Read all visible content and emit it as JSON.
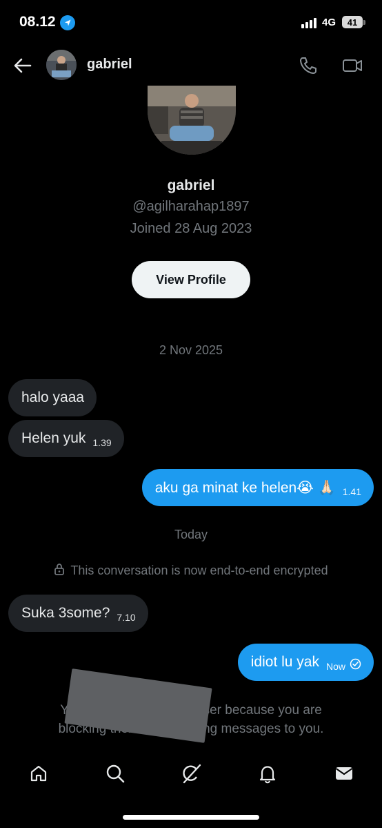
{
  "status_bar": {
    "time": "08.12",
    "network": "4G",
    "battery": "41"
  },
  "header": {
    "name": "gabriel"
  },
  "profile": {
    "name": "gabriel",
    "handle": "@agilharahap1897",
    "joined": "Joined 28 Aug 2023",
    "view_profile": "View Profile"
  },
  "dates": {
    "first": "2 Nov 2025",
    "today": "Today"
  },
  "messages": [
    {
      "side": "in",
      "text": "halo yaaa",
      "time": ""
    },
    {
      "side": "in",
      "text": "Helen yuk",
      "time": "1.39"
    },
    {
      "side": "out",
      "text": "aku ga minat ke helen😭 🙏🏻",
      "time": "1.41"
    },
    {
      "side": "in",
      "text": "Suka 3some?",
      "time": "7.10"
    },
    {
      "side": "out",
      "text": "idiot lu yak",
      "time": "Now"
    }
  ],
  "encryption_notice": "This conversation is now end-to-end encrypted",
  "blocked_notice": {
    "line1_left": "You c",
    "line1_right": "user because you are",
    "line2_left": "blocking them from s",
    "line2_right": "ing messages to you."
  },
  "bottom_nav": [
    "home-icon",
    "search-icon",
    "grok-icon",
    "notifications-icon",
    "messages-icon"
  ],
  "colors": {
    "accent": "#1d9bf0",
    "bubble_in": "#202327",
    "muted": "#71767b"
  }
}
